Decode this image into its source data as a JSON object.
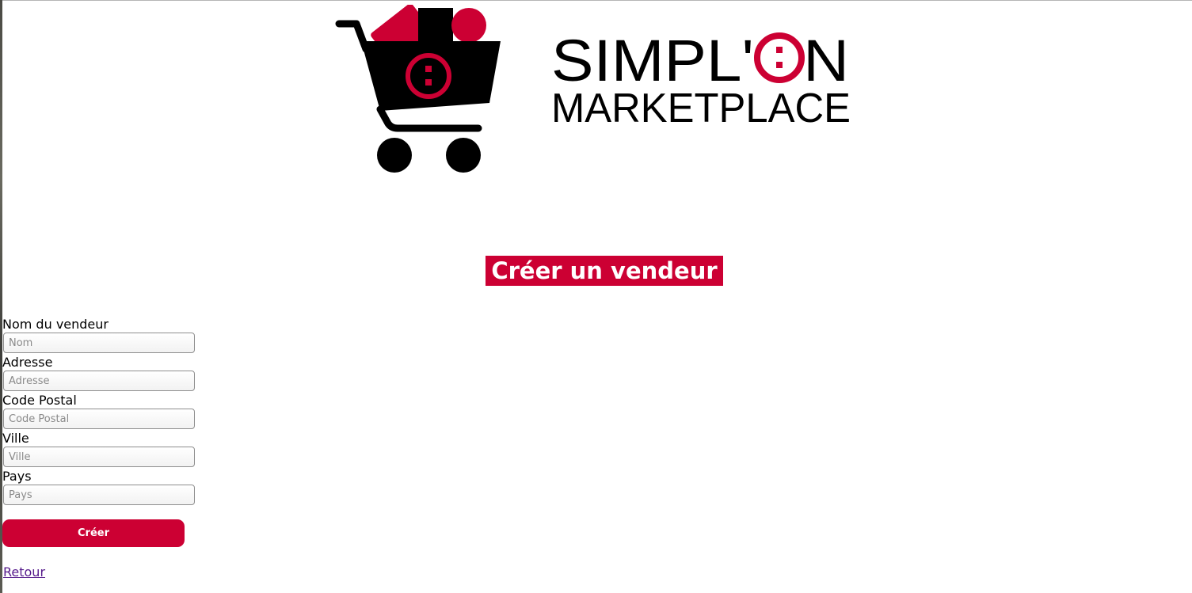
{
  "brand": {
    "line1": "SIMPL'ON",
    "line2": "MARKETPLACE",
    "colors": {
      "primary": "#cc0033",
      "dark": "#000000"
    }
  },
  "page": {
    "title": "Créer un vendeur"
  },
  "form": {
    "fields": [
      {
        "label": "Nom du vendeur",
        "placeholder": "Nom",
        "value": ""
      },
      {
        "label": "Adresse",
        "placeholder": "Adresse",
        "value": ""
      },
      {
        "label": "Code Postal",
        "placeholder": "Code Postal",
        "value": ""
      },
      {
        "label": "Ville",
        "placeholder": "Ville",
        "value": ""
      },
      {
        "label": "Pays",
        "placeholder": "Pays",
        "value": ""
      }
    ],
    "submit_label": "Créer"
  },
  "links": {
    "back_label": "Retour"
  },
  "icons": [
    "shopping-cart-logo-icon"
  ]
}
